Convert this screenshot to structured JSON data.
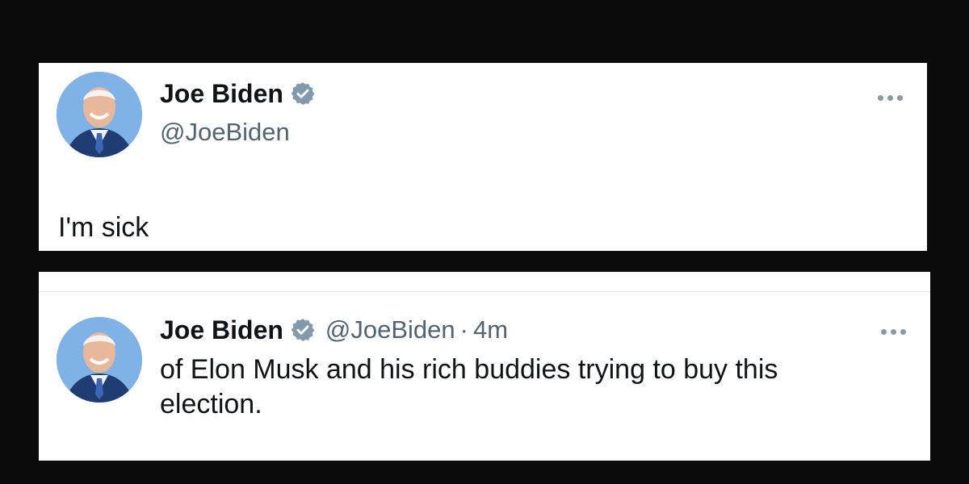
{
  "tweet_top": {
    "author_name": "Joe Biden",
    "handle": "@JoeBiden",
    "text": "I'm sick",
    "verified_icon": "verified-badge-icon",
    "more_icon": "more-options-icon",
    "avatar": "avatar-joe-biden"
  },
  "tweet_bottom": {
    "author_name": "Joe Biden",
    "handle": "@JoeBiden",
    "separator": "·",
    "time": "4m",
    "text": "of Elon Musk and his rich buddies trying to buy this election.",
    "verified_icon": "verified-badge-icon",
    "more_icon": "more-options-icon",
    "avatar": "avatar-joe-biden"
  },
  "colors": {
    "background": "#0b0b0b",
    "card": "#ffffff",
    "text_primary": "#0f1419",
    "text_secondary": "#536471",
    "verified_badge": "#829aab",
    "avatar_background": "#7fb2e6"
  }
}
